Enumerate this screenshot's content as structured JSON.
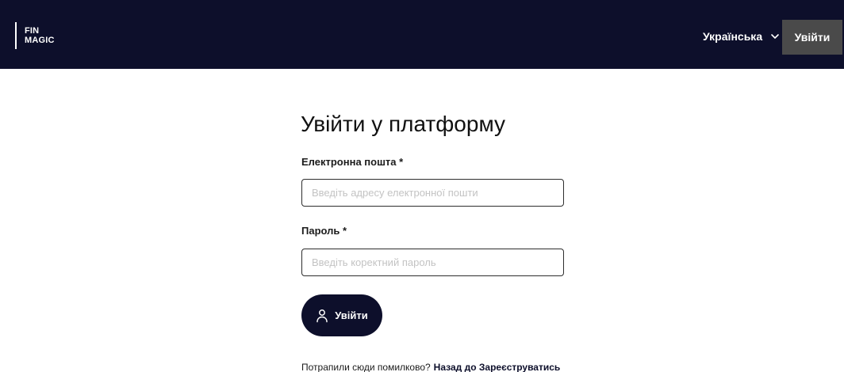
{
  "header": {
    "logo_line1": "FIN",
    "logo_line2": "MAGIC",
    "language_label": "Українська",
    "language_icon": "chevron-down-icon",
    "login_button_label": "Увійти",
    "background_color": "#0d0f2b",
    "login_button_color": "#4a4a4a"
  },
  "form": {
    "title": "Увійти у платформу",
    "email": {
      "label": "Електронна пошта *",
      "value": "",
      "placeholder": "Введіть адресу електронної пошти"
    },
    "password": {
      "label": "Пароль *",
      "value": "",
      "placeholder": "Введіть коректний пароль"
    },
    "submit": {
      "label": "Увійти",
      "icon": "user-icon",
      "color": "#0d0f2b"
    }
  },
  "footer": {
    "question": "Потрапили сюди помилково?",
    "link_label": "Назад до Зареєструватись"
  }
}
